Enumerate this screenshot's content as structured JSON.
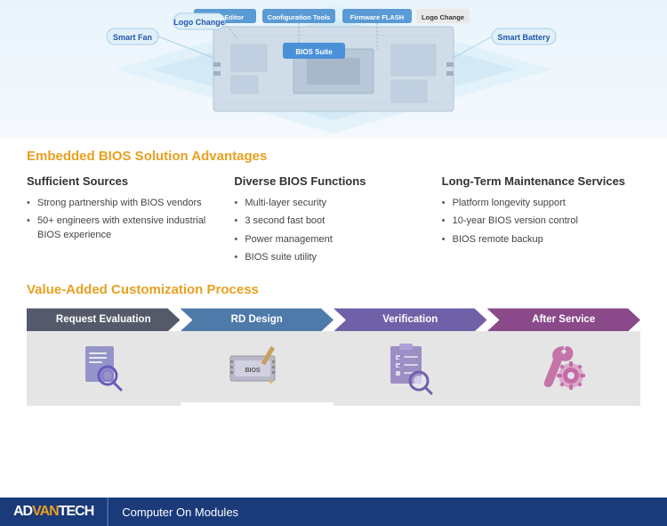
{
  "diagram": {
    "bubbles": {
      "bios_suite": "BIOS Suite",
      "config_tools": "Configuration Tools",
      "firmware_flash": "Firmware FLASH",
      "editor": "BIOS Editor",
      "logo_change_top": "Logo Change",
      "smart_fan": "Smart Fan",
      "logo_change": "Logo Change",
      "smart_battery": "Smart Battery"
    }
  },
  "main_section_title": "Embedded BIOS Solution Advantages",
  "columns": [
    {
      "title": "Sufficient Sources",
      "items": [
        "Strong partnership with BIOS vendors",
        "50+ engineers with extensive industrial BIOS experience"
      ]
    },
    {
      "title": "Diverse BIOS Functions",
      "items": [
        "Multi-layer security",
        "3 second fast boot",
        "Power management",
        "BIOS suite utility"
      ]
    },
    {
      "title": "Long-Term Maintenance Services",
      "items": [
        "Platform longevity support",
        "10-year BIOS version control",
        "BIOS remote backup"
      ]
    }
  ],
  "process_section_title": "Value-Added Customization Process",
  "steps": [
    {
      "label": "Request Evaluation",
      "color": "#555a6a",
      "icon": "search"
    },
    {
      "label": "RD Design",
      "color": "#4e7aaa",
      "icon": "bios"
    },
    {
      "label": "Verification",
      "color": "#7060a8",
      "icon": "verify"
    },
    {
      "label": "After Service",
      "color": "#8a4a8a",
      "icon": "service"
    }
  ],
  "footer": {
    "logo_ad": "AD",
    "logo_van": "VAN",
    "logo_tech": "TECH",
    "tagline": "Computer On Modules"
  }
}
